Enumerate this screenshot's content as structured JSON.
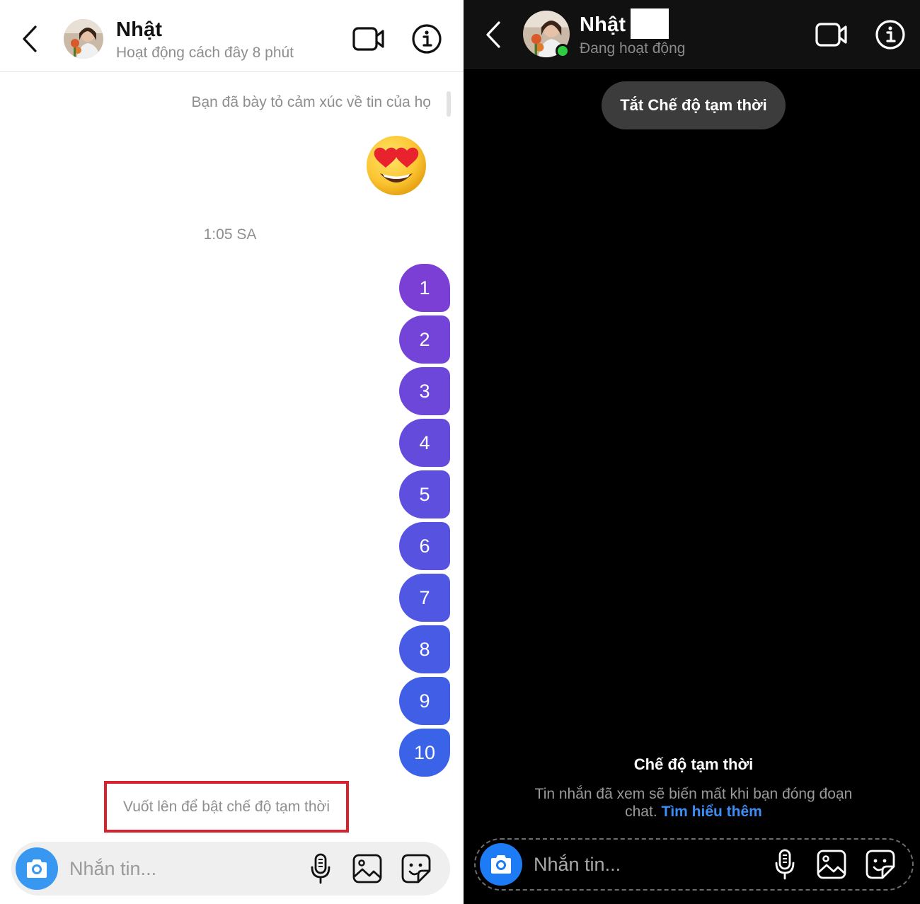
{
  "left": {
    "header": {
      "name": "Nhật",
      "status": "Hoạt động cách đây 8 phút"
    },
    "reaction_note": "Bạn đã bày tỏ cảm xúc về tin của họ",
    "timestamp": "1:05 SA",
    "messages": [
      "1",
      "2",
      "3",
      "4",
      "5",
      "6",
      "7",
      "8",
      "9",
      "10"
    ],
    "bubble_gradient": [
      "#7b3fd6",
      "#3a63e8"
    ],
    "hint": "Vuốt lên để bật chế độ tạm thời",
    "composer": {
      "placeholder": "Nhắn tin..."
    }
  },
  "right": {
    "header": {
      "name": "Nhật",
      "status": "Đang hoạt động"
    },
    "vanish_off_button": "Tắt Chế độ tạm thời",
    "vanish_title": "Chế độ tạm thời",
    "vanish_desc": "Tin nhắn đã xem sẽ biến mất khi bạn đóng đoạn chat.",
    "vanish_link": "Tìm hiểu thêm",
    "composer": {
      "placeholder": "Nhắn tin..."
    }
  },
  "colors": {
    "accent_blue": "#3897f0",
    "online_green": "#2ecc40",
    "highlight_red": "#d7232e",
    "link_blue": "#3b8ef5"
  }
}
